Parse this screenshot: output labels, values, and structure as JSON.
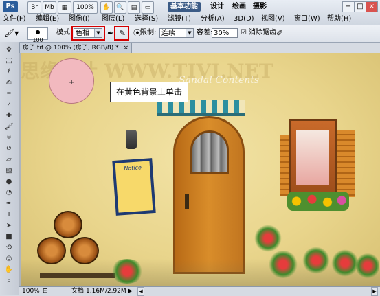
{
  "app": {
    "logo": "Ps",
    "top_buttons": [
      "Br",
      "Mb"
    ],
    "zoom": "100%",
    "workspaces": [
      "基本功能",
      "设计",
      "绘画",
      "摄影"
    ],
    "window_buttons": [
      "−",
      "□",
      "×"
    ]
  },
  "menu": [
    "文件(F)",
    "编辑(E)",
    "图像(I)",
    "图层(L)",
    "选择(S)",
    "滤镜(T)",
    "分析(A)",
    "3D(D)",
    "视图(V)",
    "窗口(W)",
    "帮助(H)"
  ],
  "options": {
    "brush_size": "100",
    "mode_label": "模式:",
    "mode_value": "色相",
    "limits_label": "限制:",
    "limits_value": "连续",
    "tolerance_label": "容差:",
    "tolerance_value": "30%",
    "antialias_label": "消除锯齿",
    "antialias_checked": true
  },
  "document": {
    "tab_title": "房子.tif @ 100% (房子, RGB/8) *",
    "close_icon": "×"
  },
  "canvas": {
    "watermark": "思缘设计 WWW.TIVI.NET",
    "subtitle": "Sandal Contents",
    "callout": "在黄色背景上单击",
    "notice_title": "Notice"
  },
  "status": {
    "zoom": "100%",
    "doc_info": "文档:1.16M/2.92M"
  },
  "tools": [
    "move-tool",
    "marquee-tool",
    "lasso-tool",
    "quick-select-tool",
    "crop-tool",
    "eyedropper-tool",
    "healing-brush-tool",
    "brush-tool",
    "clone-stamp-tool",
    "history-brush-tool",
    "eraser-tool",
    "gradient-tool",
    "blur-tool",
    "dodge-tool",
    "pen-tool",
    "type-tool",
    "path-select-tool",
    "shape-tool",
    "3d-rotate-tool",
    "3d-orbit-tool",
    "hand-tool",
    "zoom-tool"
  ],
  "colors": {
    "accent_red": "#d40000",
    "workspace_active": "#3b5b86",
    "canvas_bg": "#ead78f"
  }
}
